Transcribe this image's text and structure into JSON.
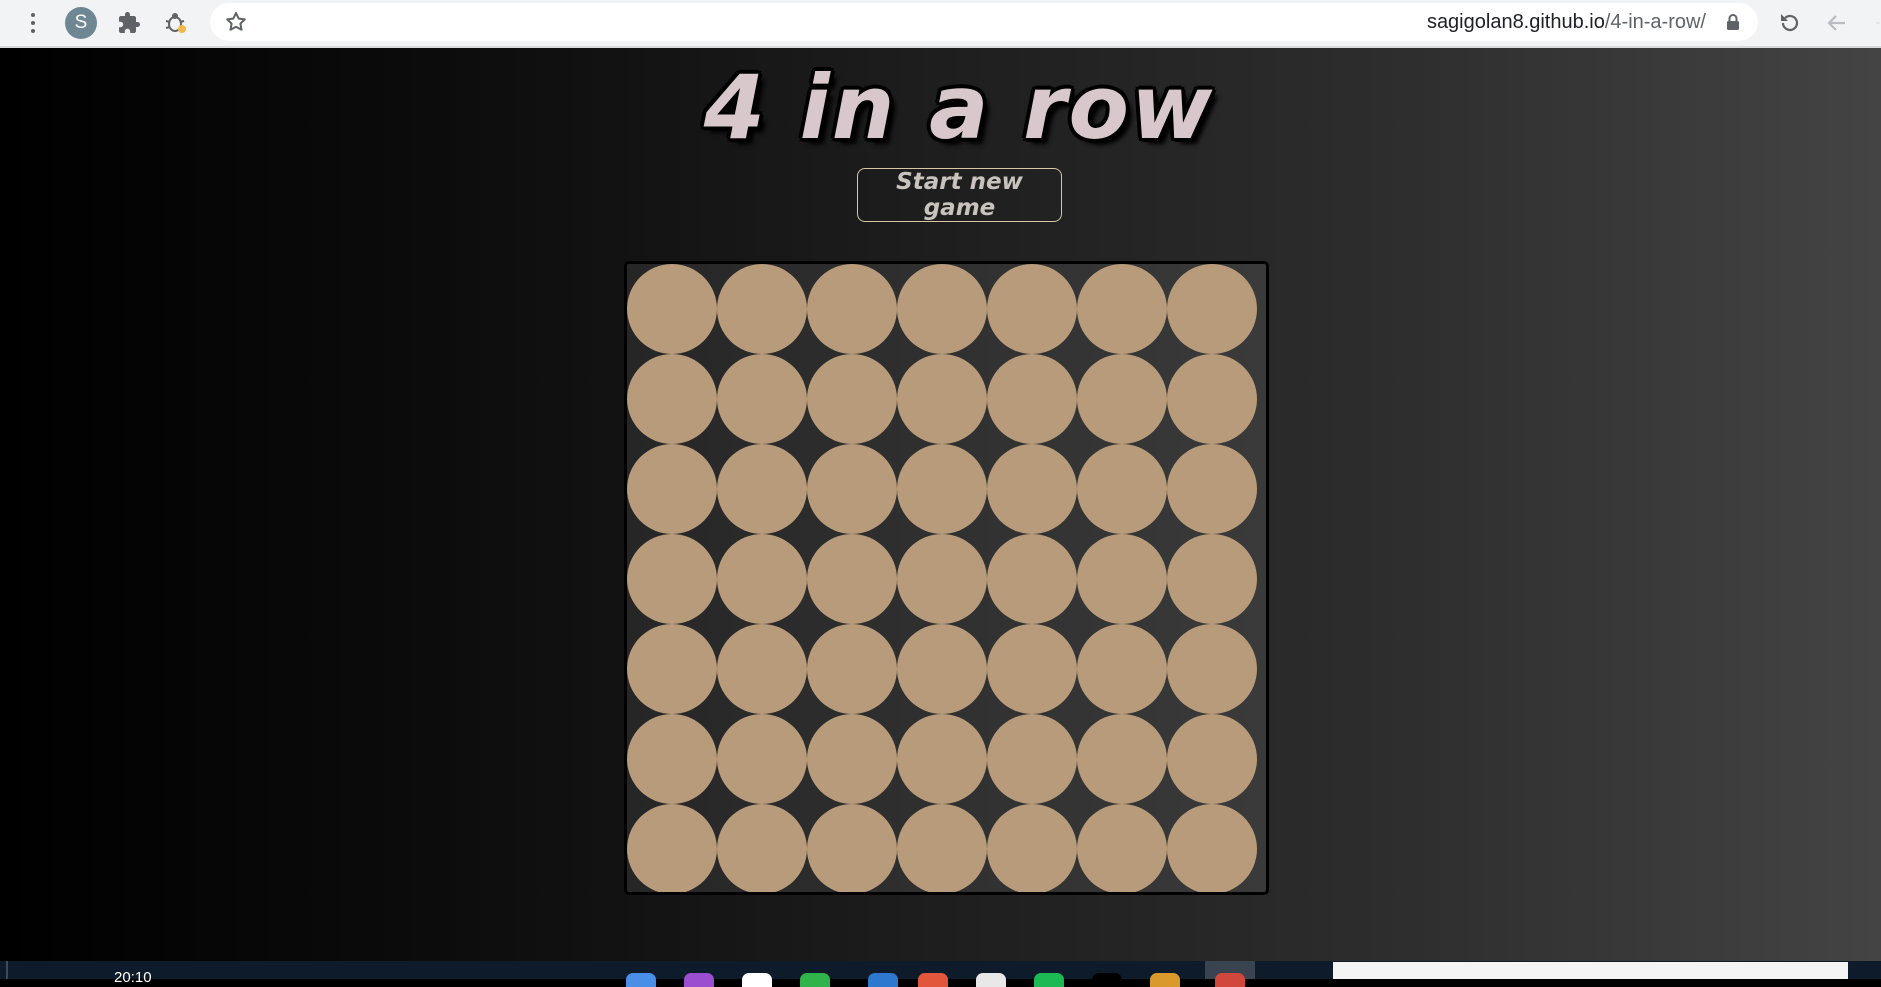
{
  "browser": {
    "profile_initial": "S",
    "url_domain": "sagigolan8.github.io",
    "url_path": "/4-in-a-row/"
  },
  "game": {
    "title": "4 in a row",
    "start_button_label": "Start new game",
    "rows": 7,
    "columns": 7,
    "board": [
      [
        "empty",
        "empty",
        "empty",
        "empty",
        "empty",
        "empty",
        "empty"
      ],
      [
        "empty",
        "empty",
        "empty",
        "empty",
        "empty",
        "empty",
        "empty"
      ],
      [
        "empty",
        "empty",
        "empty",
        "empty",
        "empty",
        "empty",
        "empty"
      ],
      [
        "empty",
        "empty",
        "empty",
        "empty",
        "empty",
        "empty",
        "empty"
      ],
      [
        "empty",
        "empty",
        "empty",
        "empty",
        "empty",
        "empty",
        "empty"
      ],
      [
        "empty",
        "empty",
        "empty",
        "empty",
        "empty",
        "empty",
        "empty"
      ],
      [
        "empty",
        "empty",
        "empty",
        "empty",
        "empty",
        "empty",
        "empty"
      ]
    ],
    "colors": {
      "empty_cell": "#b89b7a",
      "title_text": "#d8c8cc",
      "button_border": "#d6c7a6"
    }
  },
  "taskbar": {
    "clock": "20:10"
  }
}
